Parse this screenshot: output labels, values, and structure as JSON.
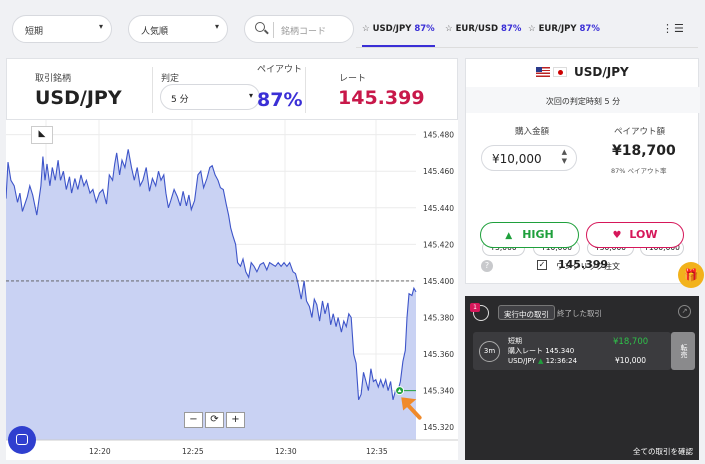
{
  "topbar": {
    "expiry_select": "短期",
    "sort_select": "人気順",
    "search_placeholder": "銘柄コード",
    "tabs": [
      {
        "label": "USD/JPY",
        "pct": "87%"
      },
      {
        "label": "EUR/USD",
        "pct": "87%"
      },
      {
        "label": "EUR/JPY",
        "pct": "87%"
      }
    ]
  },
  "info": {
    "symbol_label": "取引銘柄",
    "symbol": "USD/JPY",
    "judge_label": "判定",
    "judge_value": "5 分",
    "payout_label": "ペイアウト",
    "payout_value": "87%",
    "rate_label": "レート",
    "rate_value": "145.399"
  },
  "chart_data": {
    "type": "area",
    "x_ticks": [
      "12:20",
      "12:25",
      "12:30",
      "12:35"
    ],
    "y_ticks": [
      "145.480",
      "145.460",
      "145.440",
      "145.420",
      "145.400",
      "145.380",
      "145.360",
      "145.340",
      "145.320"
    ],
    "ylim": [
      145.313,
      145.488
    ],
    "target_line": 145.4,
    "entry_rate": 145.34,
    "zoom_controls": [
      "−",
      "⟳",
      "+"
    ]
  },
  "order": {
    "pair": "USD/JPY",
    "next_judge": "次回の判定時刻 5 分",
    "amount_label": "購入金額",
    "amount_value": "¥10,000",
    "payout_label": "ペイアウト額",
    "payout_value": "¥18,700",
    "payout_rate": "87% ペイアウト率",
    "chips": [
      "¥5,000",
      "¥10,000",
      "¥50,000",
      "¥100,000"
    ],
    "current_rate": "145.399",
    "high": "HIGH",
    "low": "LOW",
    "one_click": "ワンクリック注文",
    "help": "?"
  },
  "positions": {
    "tab_active": "実行中の取引",
    "tab_inactive": "終了した取引",
    "badge": "1",
    "duration": "3m",
    "kind": "短期",
    "entry_label": "購入レート 145.340",
    "pair": "USD/JPY",
    "time": "12:36:24",
    "payout": "¥18,700",
    "stake": "¥10,000",
    "sell": "転売",
    "all_link": "全ての取引を確認"
  },
  "colors": {
    "accent": "#3a2fd6",
    "rate": "#c8184a",
    "high": "#1fa03c",
    "low": "#d6175a",
    "gift": "#f2b21b"
  }
}
